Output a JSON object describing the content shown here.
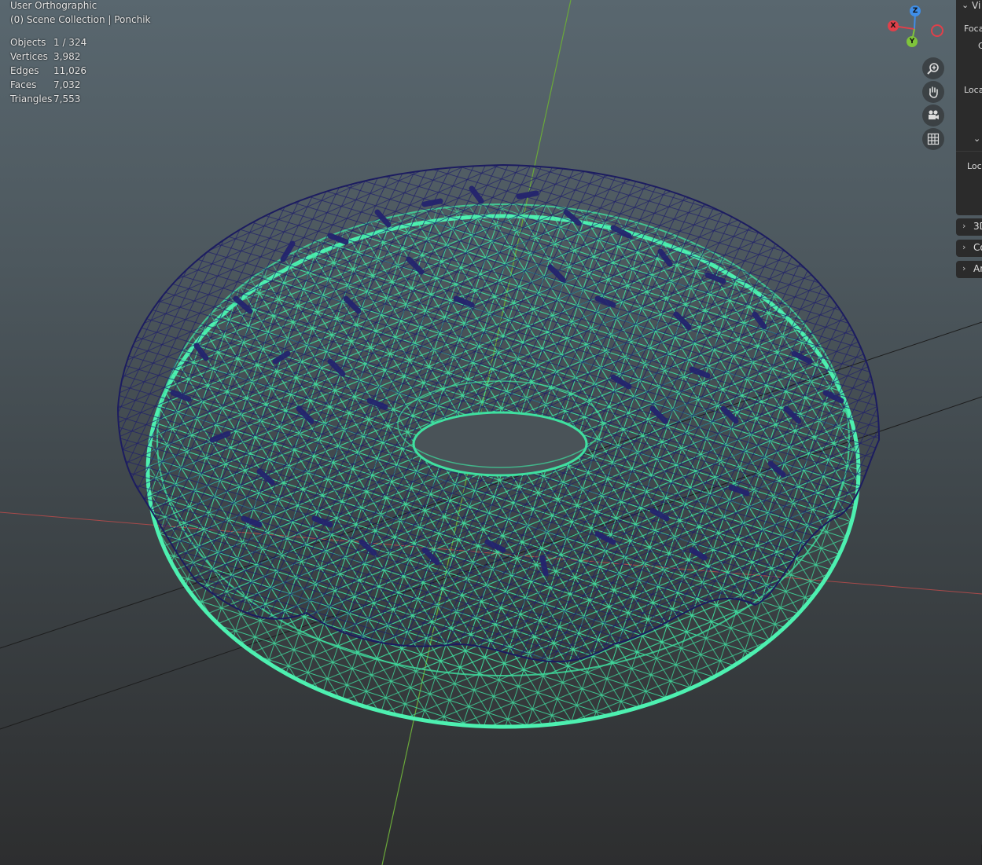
{
  "viewport": {
    "view_name": "User Orthographic",
    "collection_line": "(0) Scene Collection | Ponchik"
  },
  "stats": [
    {
      "label": "Objects",
      "value": "1 / 324"
    },
    {
      "label": "Vertices",
      "value": "3,982"
    },
    {
      "label": "Edges",
      "value": "11,026"
    },
    {
      "label": "Faces",
      "value": "7,032"
    },
    {
      "label": "Triangles",
      "value": "7,553"
    }
  ],
  "gizmo": {
    "x_label": "X",
    "y_label": "Y",
    "z_label": "Z",
    "x_color": "#e0404a",
    "y_color": "#7fc43b",
    "z_color": "#3f8ee8"
  },
  "nav_buttons": [
    {
      "icon": "zoom-icon"
    },
    {
      "icon": "hand-pan-icon"
    },
    {
      "icon": "camera-icon"
    },
    {
      "icon": "grid-icon"
    }
  ],
  "side_panel": {
    "header_partial": "Vi",
    "focal_partial": "Foca",
    "c_partial": "C",
    "location_partial": "Loca",
    "loc_partial": "Loc",
    "tabs": [
      {
        "label": "3D"
      },
      {
        "label": "Co"
      },
      {
        "label": "An"
      }
    ]
  },
  "colors": {
    "wire_green": "#3fe0a0",
    "wire_blue": "#1e1e6a",
    "accent": "#3fe0a0"
  }
}
